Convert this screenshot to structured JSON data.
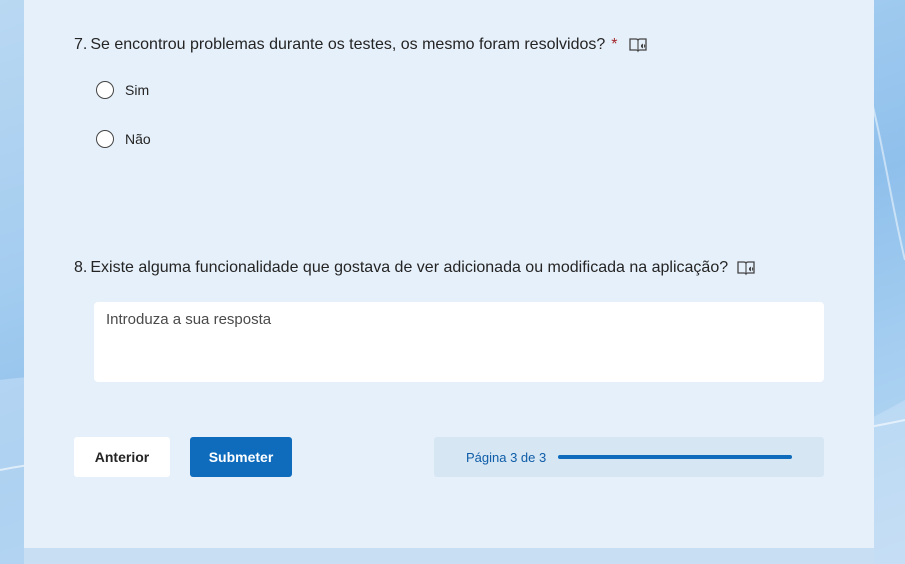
{
  "questions": [
    {
      "number": "7.",
      "text": "Se encontrou problemas durante os testes, os mesmo foram resolvidos?",
      "required_mark": "*",
      "options": [
        "Sim",
        "Não"
      ]
    },
    {
      "number": "8.",
      "text": "Existe alguma funcionalidade que gostava de ver adicionada ou modificada na aplicação?",
      "placeholder": "Introduza a sua resposta"
    }
  ],
  "buttons": {
    "previous": "Anterior",
    "submit": "Submeter"
  },
  "progress": {
    "label": "Página 3 de 3",
    "fraction": 1.0
  },
  "icons": {
    "reader": "immersive-reader-icon",
    "radio": "radio-button-icon"
  },
  "colors": {
    "accent": "#0f6cbd",
    "required": "#a4262c",
    "card": "#e6f0fa"
  }
}
